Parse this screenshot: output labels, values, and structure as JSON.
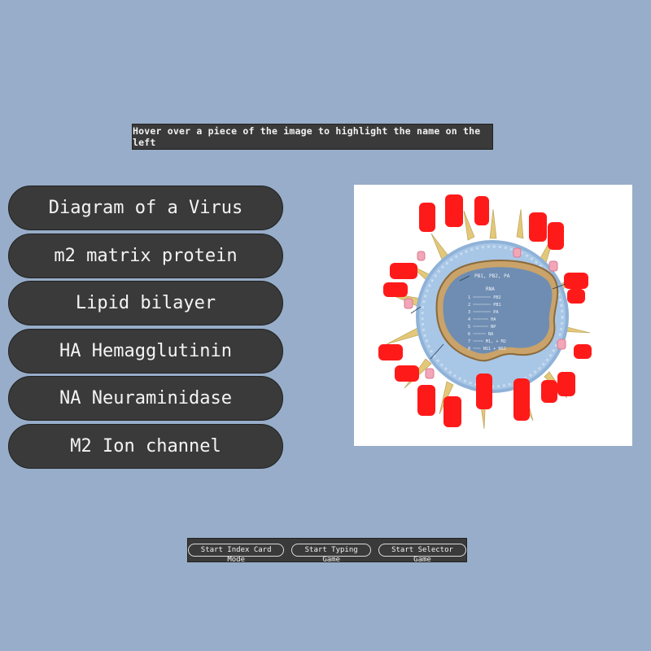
{
  "instruction": "Hover over a piece of the image to highlight the name on the left",
  "labels": [
    "Diagram of a Virus",
    "m2 matrix protein",
    "Lipid bilayer",
    "HA Hemagglutinin",
    "NA Neuraminidase",
    "M2 Ion channel"
  ],
  "figure": {
    "segment_header": "PB1, PB2, PA",
    "rna_label": "RNA",
    "segments": [
      "1  ~~~~~~~ PB2",
      "2  ~~~~~~~ PB1",
      "3  ~~~~~~~ PA",
      "4  ~~~~~~ HA",
      "5  ~~~~~~ NP",
      "6  ~~~~~ NA",
      "7  ~~~~ M1, + M2",
      "8  ~~~ NS1 + NS2"
    ],
    "colors": {
      "spike_ha": "#ff1a1a",
      "spike_na": "#e2c878",
      "envelope": "#a8c6e6",
      "capsid": "#c9a36a"
    }
  },
  "buttons": {
    "index_card": "Start Index Card Mode",
    "typing": "Start Typing Game",
    "selector": "Start Selector Game"
  }
}
